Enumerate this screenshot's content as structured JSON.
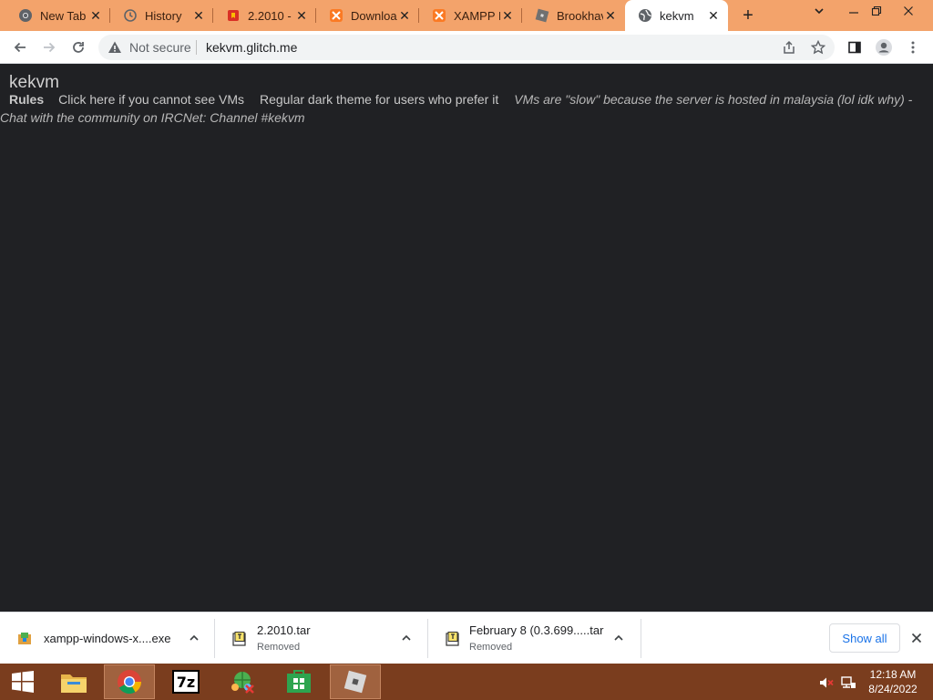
{
  "browser": {
    "tabs": [
      {
        "label": "New Tab",
        "icon": "chrome-icon",
        "active": false
      },
      {
        "label": "History",
        "icon": "history-icon",
        "active": false
      },
      {
        "label": "2.2010 -",
        "icon": "red-bookmark-icon",
        "active": false
      },
      {
        "label": "Downloa",
        "icon": "xampp-icon",
        "active": false
      },
      {
        "label": "XAMPP I",
        "icon": "xampp-icon",
        "active": false
      },
      {
        "label": "Brookhav",
        "icon": "roblox-icon",
        "active": false
      },
      {
        "label": "kekvm",
        "icon": "globe-icon",
        "active": true
      }
    ],
    "new_tab_symbol": "+",
    "address_bar": {
      "security_label": "Not secure",
      "url": "kekvm.glitch.me"
    }
  },
  "page": {
    "title": "kekvm",
    "nav_links": [
      "Rules",
      "Click here if you cannot see VMs",
      "Regular dark theme for users who prefer it"
    ],
    "notice": "VMs are \"slow\" because the server is hosted in malaysia (lol idk why) - Chat with the community on IRCNet: Channel #kekvm",
    "background_color": "#202124"
  },
  "downloads": {
    "items": [
      {
        "name": "xampp-windows-x....exe",
        "status": ""
      },
      {
        "name": "2.2010.tar",
        "status": "Removed"
      },
      {
        "name": "February 8 (0.3.699.....tar",
        "status": "Removed"
      }
    ],
    "show_all_label": "Show all"
  },
  "taskbar": {
    "apps": [
      "start-icon",
      "file-explorer-icon",
      "chrome-icon",
      "7zip-icon",
      "network-app-icon",
      "store-icon",
      "roblox-icon"
    ],
    "seven_zip_label": "7z",
    "clock_time": "12:18 AM",
    "clock_date": "8/24/2022"
  },
  "colors": {
    "tabstrip": "#f3a36b",
    "taskbar": "#7a3d1e",
    "link_blue": "#1a73e8"
  }
}
